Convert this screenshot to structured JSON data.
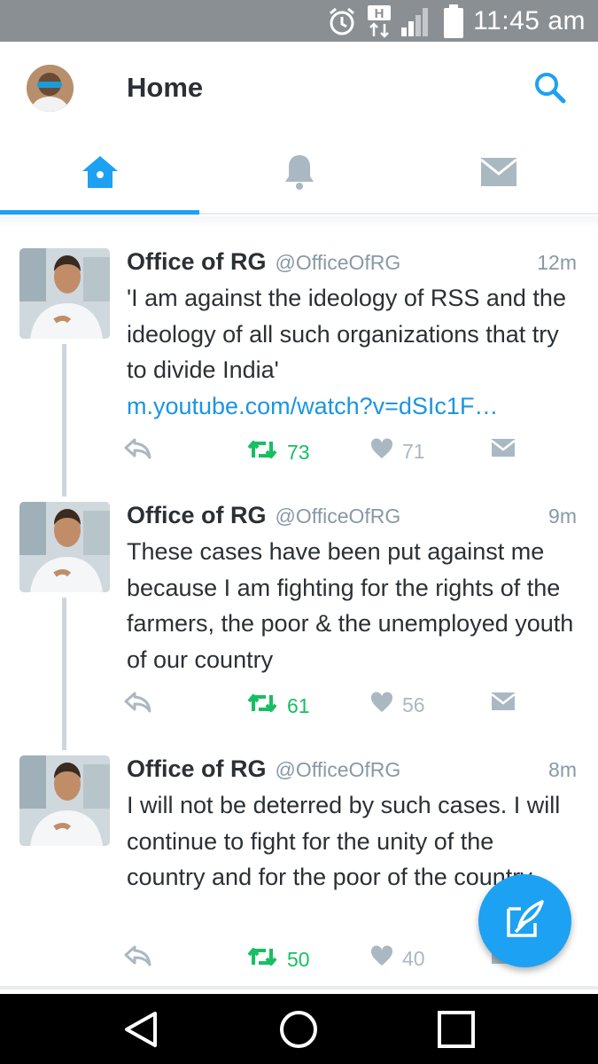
{
  "status_bar": {
    "time": "11:45 am",
    "network": "H",
    "icons": [
      "alarm-clock-icon",
      "network-h-icon",
      "signal-icon",
      "battery-icon"
    ]
  },
  "app_bar": {
    "title": "Home",
    "icons": [
      "profile-avatar",
      "search-icon"
    ]
  },
  "tabs": [
    {
      "name": "home",
      "icon": "home-icon",
      "active": true
    },
    {
      "name": "notifications",
      "icon": "bell-icon",
      "active": false
    },
    {
      "name": "messages",
      "icon": "envelope-icon",
      "active": false
    }
  ],
  "tweets": [
    {
      "name": "Office of RG",
      "handle": "@OfficeOfRG",
      "time": "12m",
      "text": "'I am against the ideology of RSS and the ideology of all such organizations that try to divide India'",
      "link": "m.youtube.com/watch?v=dSIc1F…",
      "retweets": "73",
      "likes": "71"
    },
    {
      "name": "Office of RG",
      "handle": "@OfficeOfRG",
      "time": "9m",
      "text": "These cases have been put against me because I am fighting for the rights of the farmers, the poor &  the unemployed youth of our country",
      "link": "",
      "retweets": "61",
      "likes": "56"
    },
    {
      "name": "Office of RG",
      "handle": "@OfficeOfRG",
      "time": "8m",
      "text": "I will not be deterred by such cases. I will continue to fight for the unity of the country and for the poor of the country",
      "link": "",
      "retweets": "50",
      "likes": "40"
    }
  ],
  "colors": {
    "accent": "#1da1f2",
    "retweet": "#17bf63",
    "muted": "#8899a6",
    "status_bar": "#8a8f93"
  },
  "nav_bar": {
    "icons": [
      "back-icon",
      "home-circle-icon",
      "recents-icon"
    ]
  }
}
